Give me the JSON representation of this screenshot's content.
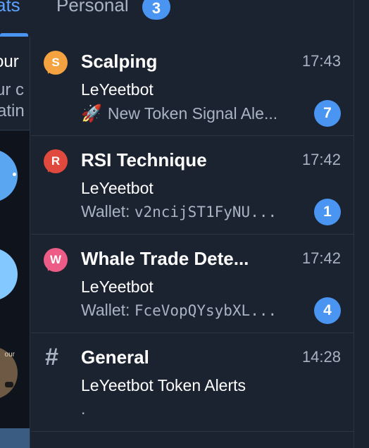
{
  "tabs": {
    "chats_label": "ats",
    "personal_label": "Personal",
    "personal_count": "3"
  },
  "left_pane": {
    "line1": "our",
    "line2": "ur c",
    "line3": "atin",
    "avatar3_label": "our"
  },
  "chats": [
    {
      "avatar_letter": "S",
      "title": "Scalping",
      "time": "17:43",
      "sender": "LeYeetbot",
      "preview": "New Token Signal Ale...",
      "unread": "7"
    },
    {
      "avatar_letter": "R",
      "title": "RSI Technique",
      "time": "17:42",
      "sender": "LeYeetbot",
      "preview_prefix": "Wallet: ",
      "preview": "v2ncijST1FyNU...",
      "unread": "1"
    },
    {
      "avatar_letter": "W",
      "title": "Whale Trade Dete...",
      "time": "17:42",
      "sender": "LeYeetbot",
      "preview_prefix": "Wallet: ",
      "preview": "FceVopQYsybXL...",
      "unread": "4"
    },
    {
      "avatar_icon": "#",
      "title": "General",
      "time": "14:28",
      "sender": "LeYeetbot Token Alerts",
      "preview": "."
    }
  ],
  "icons": {
    "rocket": "🚀"
  },
  "colors": {
    "background": "#1c2330",
    "accent": "#4a95f2",
    "muted_text": "#a8b4c4",
    "avatar_scalping": "#f4a340",
    "avatar_rsi": "#e0493d",
    "avatar_whale": "#ec5c87"
  }
}
